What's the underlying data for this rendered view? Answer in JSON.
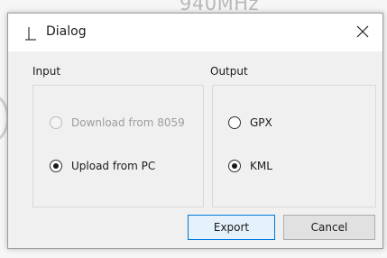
{
  "background": {
    "text": "940MHz"
  },
  "dialog": {
    "title": "Dialog",
    "close_icon": "close-icon",
    "input_group": {
      "label": "Input",
      "options": [
        {
          "label": "Download from 8059",
          "selected": false,
          "enabled": false
        },
        {
          "label": "Upload from PC",
          "selected": true,
          "enabled": true
        }
      ]
    },
    "output_group": {
      "label": "Output",
      "options": [
        {
          "label": "GPX",
          "selected": false,
          "enabled": true
        },
        {
          "label": "KML",
          "selected": true,
          "enabled": true
        }
      ]
    },
    "buttons": {
      "export": "Export",
      "cancel": "Cancel"
    }
  },
  "colors": {
    "accent": "#0078d7",
    "disabled_text": "#9d9d9d"
  }
}
